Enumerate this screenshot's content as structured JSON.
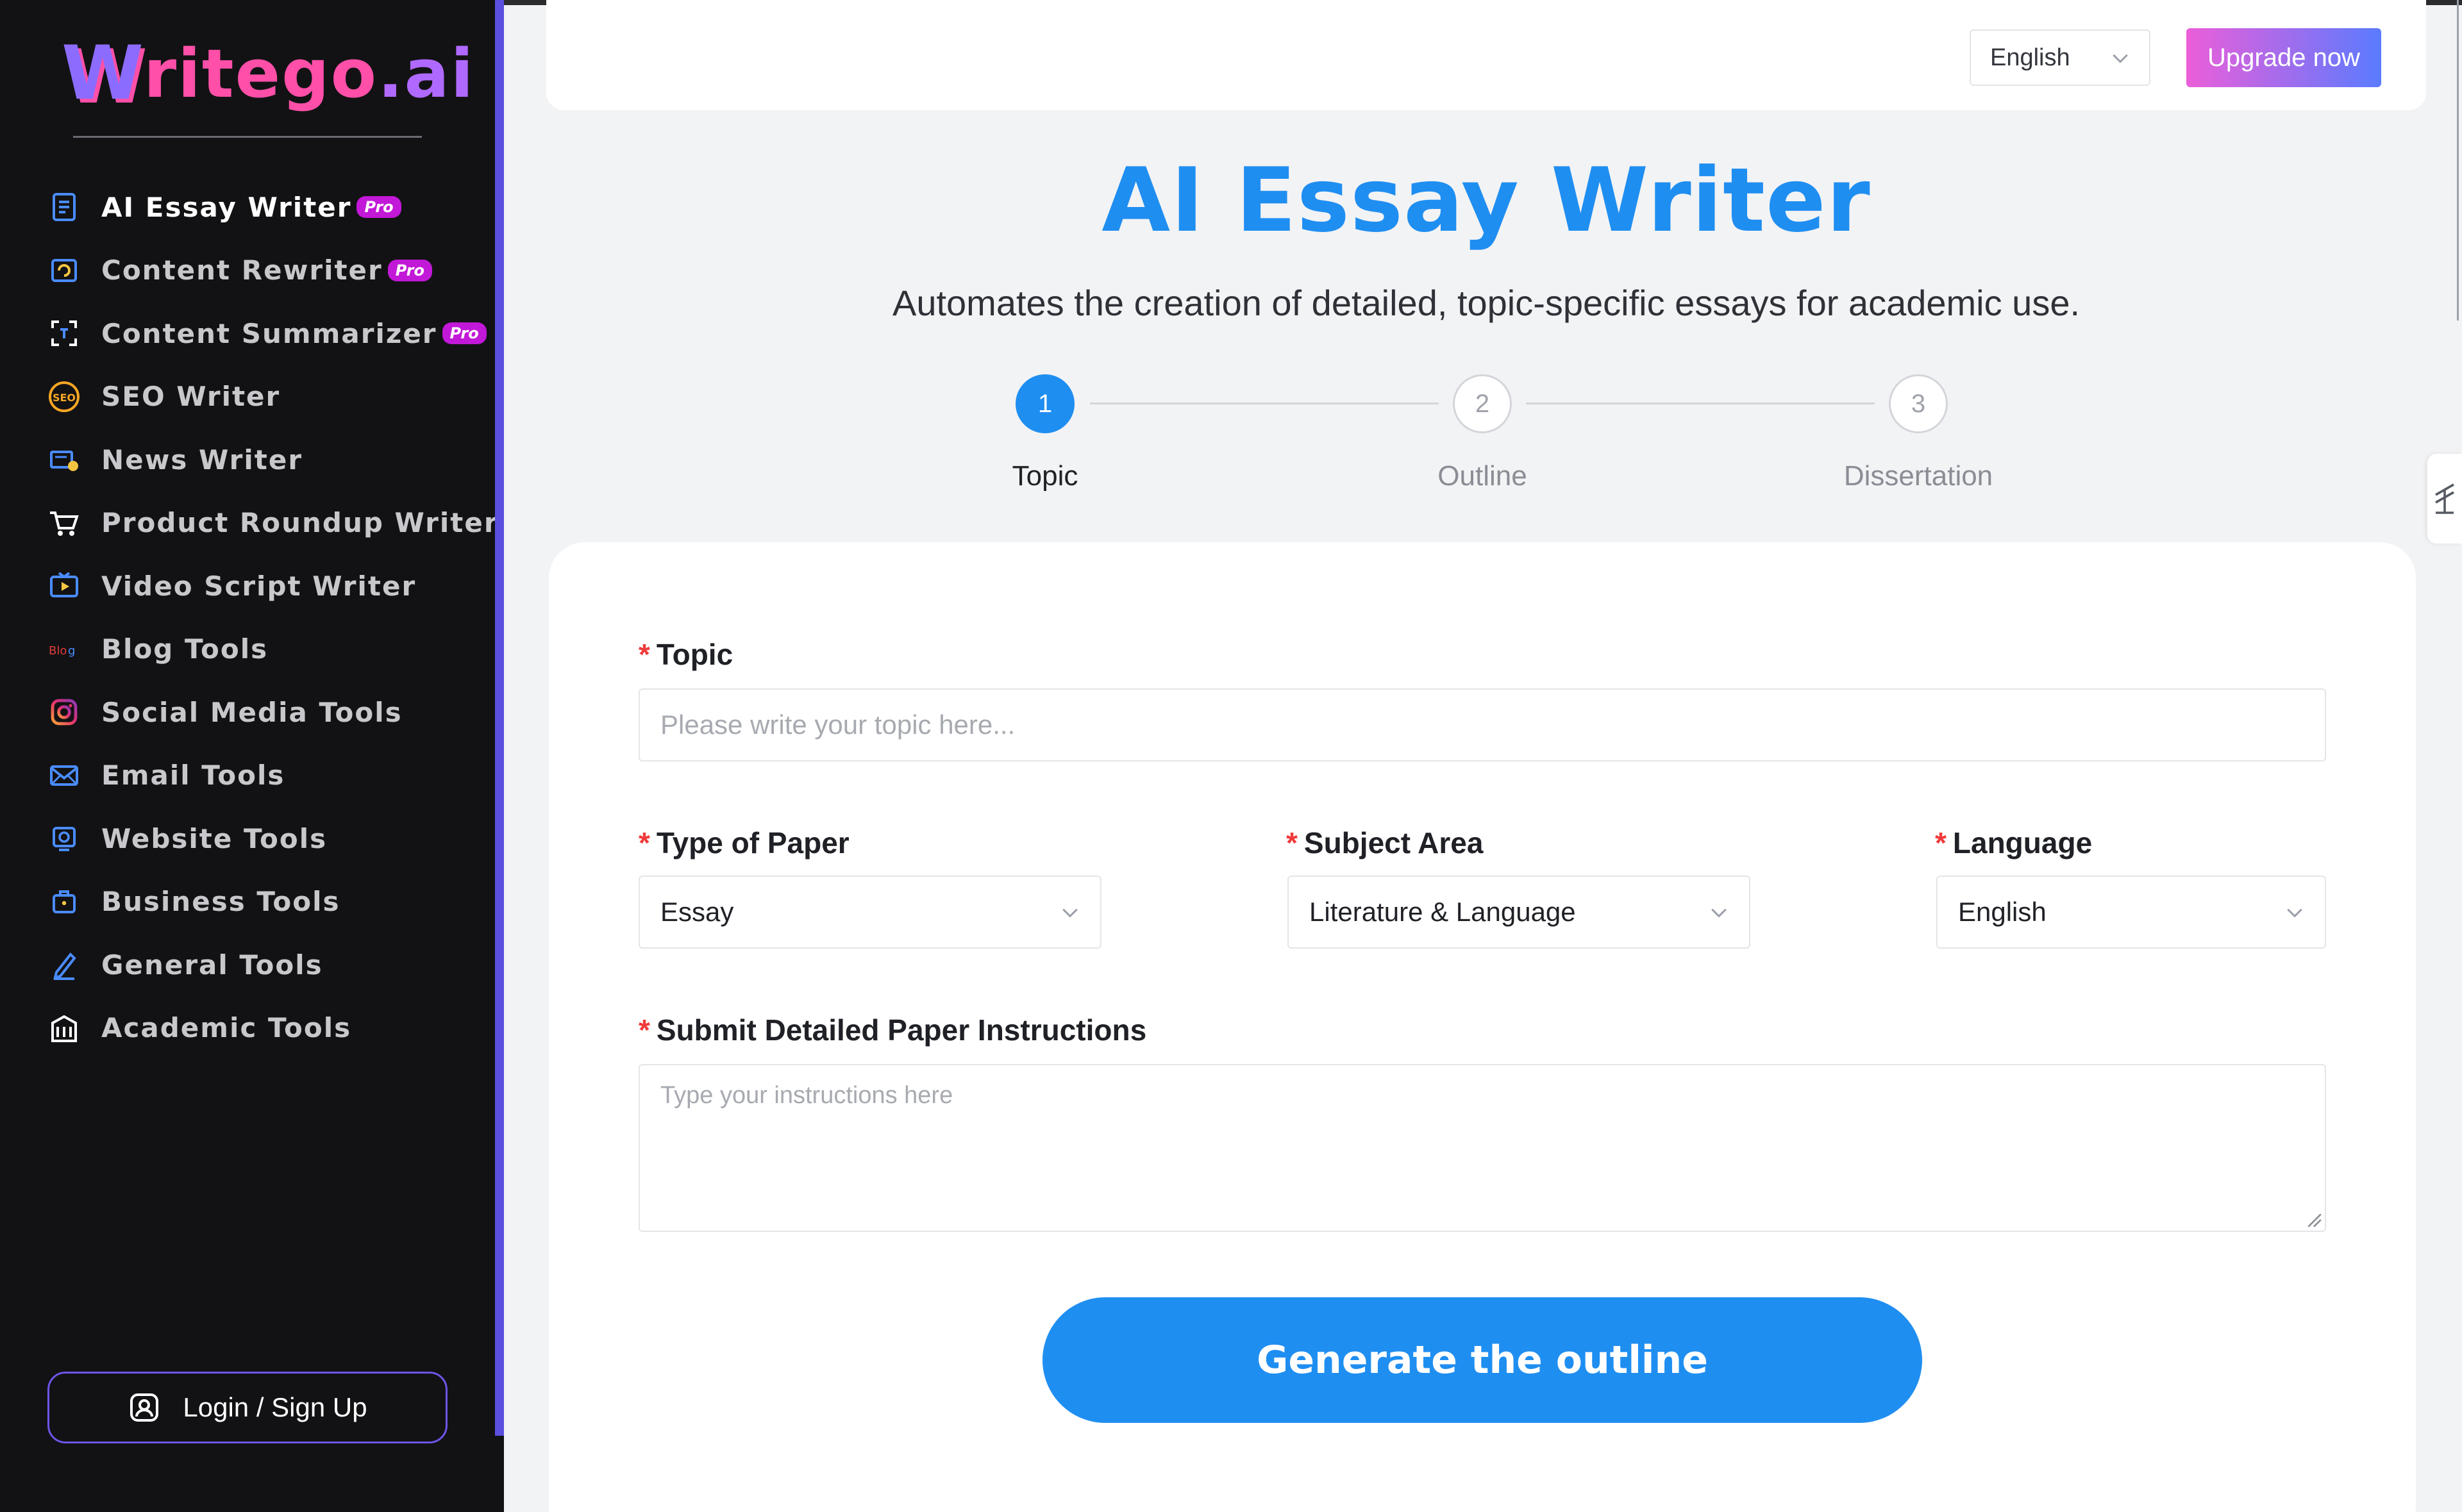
{
  "brand": {
    "logo_w": "W",
    "logo_text": "ritego",
    "logo_suffix": ".ai"
  },
  "sidebar": {
    "items": [
      {
        "label": "AI Essay Writer",
        "badge": "Pro",
        "icon": "document-icon"
      },
      {
        "label": "Content Rewriter",
        "badge": "Pro",
        "icon": "rewrite-icon"
      },
      {
        "label": "Content Summarizer",
        "badge": "Pro",
        "icon": "summarize-icon"
      },
      {
        "label": "SEO Writer",
        "icon": "seo-icon"
      },
      {
        "label": "News Writer",
        "icon": "news-icon"
      },
      {
        "label": "Product Roundup Writer",
        "icon": "cart-icon"
      },
      {
        "label": "Video Script Writer",
        "icon": "video-icon"
      },
      {
        "label": "Blog Tools",
        "icon": "blog-icon"
      },
      {
        "label": "Social Media Tools",
        "icon": "instagram-icon"
      },
      {
        "label": "Email Tools",
        "icon": "email-icon"
      },
      {
        "label": "Website Tools",
        "icon": "website-icon"
      },
      {
        "label": "Business Tools",
        "icon": "briefcase-icon"
      },
      {
        "label": "General Tools",
        "icon": "pen-icon"
      },
      {
        "label": "Academic Tools",
        "icon": "building-icon"
      }
    ],
    "login_label": "Login / Sign Up"
  },
  "header": {
    "language": "English",
    "upgrade_label": "Upgrade now"
  },
  "main": {
    "title": "AI Essay Writer",
    "subtitle": "Automates the creation of detailed, topic-specific essays for academic use.",
    "steps": [
      {
        "number": "1",
        "label": "Topic",
        "active": true
      },
      {
        "number": "2",
        "label": "Outline",
        "active": false
      },
      {
        "number": "3",
        "label": "Dissertation",
        "active": false
      }
    ]
  },
  "form": {
    "required_mark": "*",
    "topic": {
      "label": "Topic",
      "placeholder": "Please write your topic here..."
    },
    "paper_type": {
      "label": "Type of Paper",
      "value": "Essay"
    },
    "subject_area": {
      "label": "Subject Area",
      "value": "Literature & Language"
    },
    "language": {
      "label": "Language",
      "value": "English"
    },
    "instructions": {
      "label": "Submit Detailed Paper Instructions",
      "placeholder": "Type your instructions here"
    },
    "generate_label": "Generate the outline"
  },
  "colors": {
    "accent": "#1f8ef1",
    "sidebar_bg": "#121214",
    "pro_badge": "#c218d8",
    "required": "#f03a3a"
  }
}
